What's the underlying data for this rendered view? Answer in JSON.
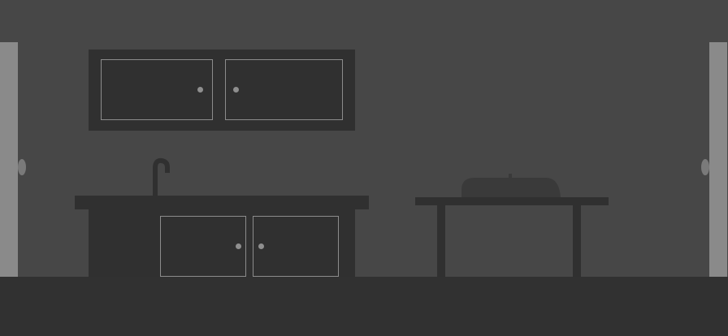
{
  "scene": {
    "name": "kitchen-room",
    "colors": {
      "wall": "#474747",
      "floor": "#313131",
      "door": "#8a8a8a",
      "door_knob": "#7a7a7a",
      "furniture": "#303030",
      "outline": "#8c8c8c",
      "handle": "#8f8f8f"
    },
    "objects": [
      {
        "id": "door-left",
        "type": "door",
        "interactable": true
      },
      {
        "id": "door-right",
        "type": "door",
        "interactable": true
      },
      {
        "id": "upper-cabinet",
        "type": "cabinet",
        "doors": 2,
        "interactable": true
      },
      {
        "id": "sink-counter",
        "type": "counter-with-sink",
        "interactable": true
      },
      {
        "id": "lower-cabinet",
        "type": "cabinet",
        "doors": 2,
        "interactable": true
      },
      {
        "id": "table",
        "type": "table",
        "interactable": true
      },
      {
        "id": "covered-dish",
        "type": "cloche",
        "interactable": true
      }
    ]
  }
}
